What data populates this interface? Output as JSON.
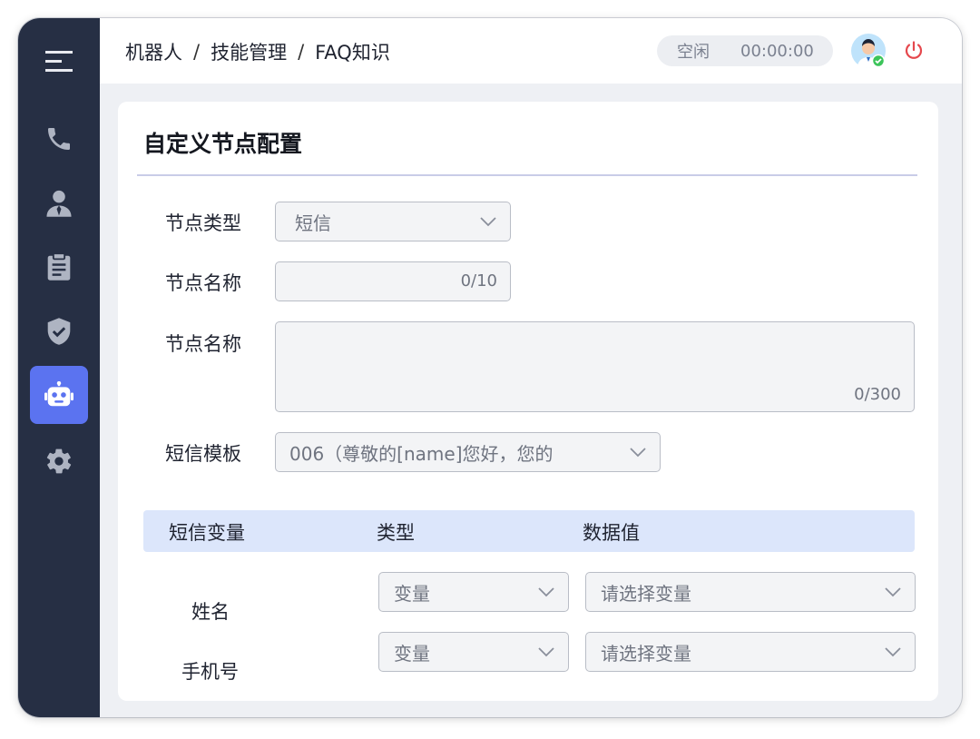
{
  "breadcrumb": [
    "机器人",
    "技能管理",
    "FAQ知识"
  ],
  "breadcrumb_sep": "/",
  "status": {
    "state": "空闲",
    "timer": "00:00:00"
  },
  "colors": {
    "sidebar": "#262f44",
    "accent": "#5b73f0",
    "power": "#e5484d",
    "online": "#3cc45a",
    "table_header": "#dce6fb"
  },
  "sidebar": {
    "items": [
      {
        "icon": "menu-icon"
      },
      {
        "icon": "phone-icon"
      },
      {
        "icon": "user-icon"
      },
      {
        "icon": "clipboard-icon"
      },
      {
        "icon": "shield-check-icon"
      },
      {
        "icon": "robot-icon",
        "active": true
      },
      {
        "icon": "gear-icon"
      }
    ]
  },
  "card": {
    "title": "自定义节点配置",
    "node_type": {
      "label": "节点类型",
      "value": "短信"
    },
    "node_name": {
      "label": "节点名称",
      "counter": "0/10"
    },
    "node_desc": {
      "label": "节点名称",
      "counter": "0/300"
    },
    "sms_template": {
      "label": "短信模板",
      "value": "006（尊敬的[name]您好，您的"
    },
    "variables": {
      "headers": [
        "短信变量",
        "类型",
        "数据值"
      ],
      "rows": [
        {
          "name": "姓名",
          "type": "变量",
          "value_placeholder": "请选择变量"
        },
        {
          "name": "手机号",
          "type": "变量",
          "value_placeholder": "请选择变量"
        }
      ]
    }
  }
}
